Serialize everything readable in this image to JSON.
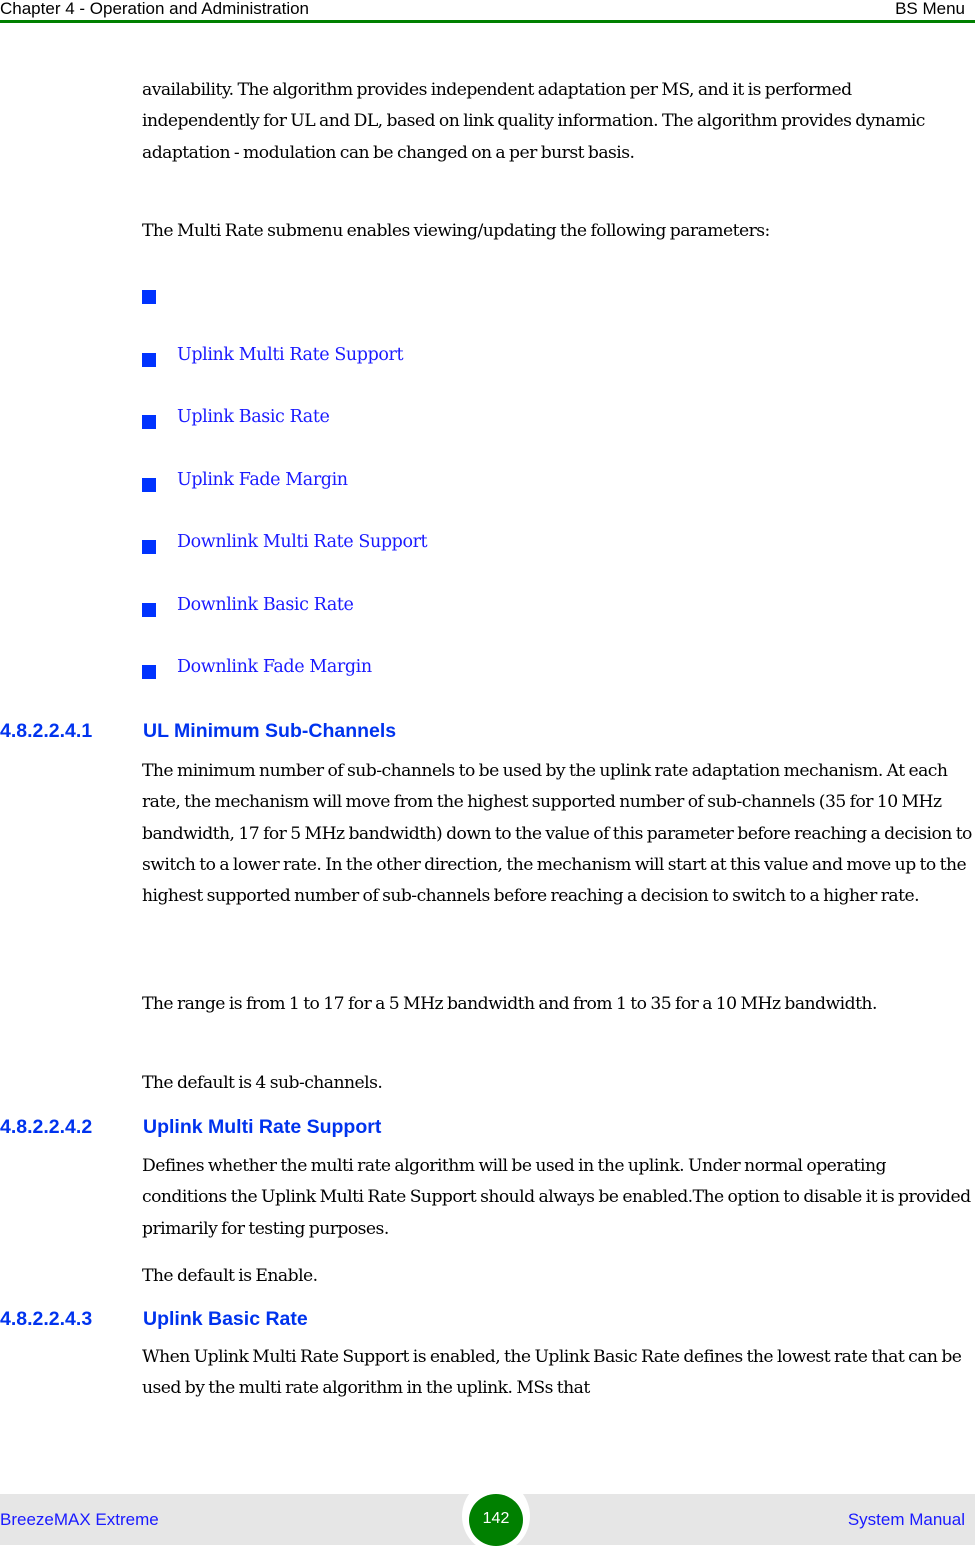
{
  "header": {
    "chapter": "Chapter 4 - Operation and Administration",
    "section": "BS Menu",
    "rule_color": "#008000"
  },
  "intro": {
    "paragraph": "availability. The algorithm provides independent adaptation per MS, and it is performed independently for UL and DL, based on link quality information. The algorithm provides dynamic adaptation - modulation can be changed on a per burst basis.",
    "submenu_text": "The Multi Rate submenu enables viewing/updating the following parameters:"
  },
  "bullets": [
    {
      "label": ""
    },
    {
      "label": "Uplink Multi Rate Support"
    },
    {
      "label": "Uplink Basic Rate"
    },
    {
      "label": "Uplink Fade Margin"
    },
    {
      "label": "Downlink Multi Rate Support"
    },
    {
      "label": "Downlink Basic Rate"
    },
    {
      "label": "Downlink Fade Margin"
    }
  ],
  "sections": [
    {
      "number": "4.8.2.2.4.1",
      "title": "UL Minimum Sub-Channels",
      "paragraphs": [
        "The minimum number of sub-channels to be used by the uplink rate adaptation mechanism. At each rate, the mechanism will move from the highest supported number of sub-channels (35 for 10 MHz bandwidth, 17 for 5 MHz bandwidth) down to the value of this parameter before reaching a decision to switch to a lower rate. In the other direction, the mechanism will start at this value and move up to the highest supported number of sub-channels before reaching a decision to switch to a higher rate.",
        "The range is from 1 to 17 for a 5 MHz bandwidth and from 1 to 35 for a 10 MHz bandwidth.",
        "The default is 4 sub-channels."
      ]
    },
    {
      "number": "4.8.2.2.4.2",
      "title": "Uplink Multi Rate Support",
      "paragraphs": [
        "Defines whether the multi rate algorithm will be used in the uplink. Under normal operating conditions the Uplink Multi Rate Support should always be enabled.The option to disable it is provided primarily for testing purposes.",
        "The default is Enable."
      ]
    },
    {
      "number": "4.8.2.2.4.3",
      "title": "Uplink Basic Rate",
      "paragraphs": [
        "When Uplink Multi Rate Support is enabled, the Uplink Basic Rate defines the lowest rate that can be used by the multi rate algorithm in the uplink. MSs that"
      ]
    }
  ],
  "footer": {
    "product": "BreezeMAX Extreme",
    "page_number": "142",
    "doc_type": "System Manual",
    "badge_color": "#008000"
  }
}
